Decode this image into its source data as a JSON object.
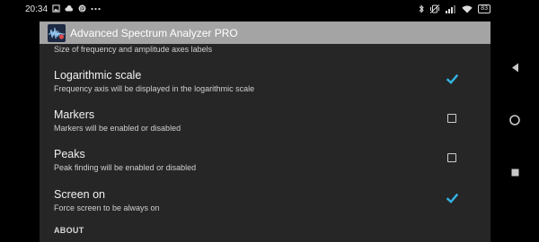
{
  "status_bar": {
    "time": "20:34",
    "battery": "83",
    "left_icons": [
      "gallery-icon",
      "cloud-icon",
      "at-icon",
      "more-dots-icon"
    ],
    "right_icons": [
      "bluetooth-icon",
      "vibrate-icon",
      "signal-icon",
      "wifi-icon",
      "battery-icon"
    ]
  },
  "app_bar": {
    "title": "Advanced Spectrum Analyzer PRO",
    "icon": "spectrum-app-icon"
  },
  "settings": {
    "partial_summary": "Size of frequency and amplitude axes labels",
    "items": [
      {
        "title": "Logarithmic scale",
        "summary": "Frequency axis will be displayed in the logarithmic scale",
        "checked": true
      },
      {
        "title": "Markers",
        "summary": "Markers will be enabled or disabled",
        "checked": false
      },
      {
        "title": "Peaks",
        "summary": "Peak finding will be enabled or disabled",
        "checked": false
      },
      {
        "title": "Screen on",
        "summary": "Force screen to be always on",
        "checked": true
      }
    ],
    "section_header": "ABOUT"
  },
  "colors": {
    "check_accent": "#33b5e5",
    "app_bar": "#a4a4a4",
    "background": "#262626"
  },
  "nav_bar": {
    "buttons": [
      "back-icon",
      "home-icon",
      "recents-icon"
    ]
  }
}
